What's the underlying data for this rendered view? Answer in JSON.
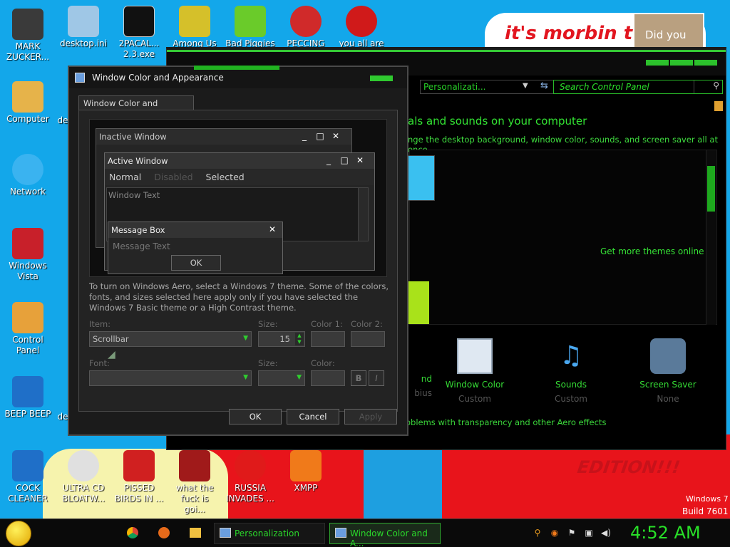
{
  "wallpaper": {
    "banner": "it's morbin t",
    "face_caption": "Did you",
    "edition": "EDITION!!!",
    "os": "Windows 7",
    "build": "Build 7601"
  },
  "desktop_icons": [
    {
      "label": "MARK ZUCKER...",
      "color": "#3a3a3a"
    },
    {
      "label": "Computer",
      "color": "#e6b34a"
    },
    {
      "label": "Network",
      "color": "#3ab3f0"
    },
    {
      "label": "Windows Vista",
      "color": "#c8202a"
    },
    {
      "label": "Control Panel",
      "color": "#e7a13a"
    },
    {
      "label": "BEEP BEEP",
      "color": "#1f6fc8"
    },
    {
      "label": "COCK CLEANER",
      "color": "#1f6fc8"
    },
    {
      "label": "desktop.ini",
      "color": "#9fc7e6"
    },
    {
      "label": "2PACAL... 2.3.exe",
      "color": "#111111"
    },
    {
      "label": "Among Us",
      "color": "#d5c02a"
    },
    {
      "label": "Bad Piggies",
      "color": "#6acb2a"
    },
    {
      "label": "PECCING",
      "color": "#d02a2a"
    },
    {
      "label": "you all are",
      "color": "#d01a1a"
    },
    {
      "label": "ULTRA CD BLOATW...",
      "color": "#e0e0e0"
    },
    {
      "label": "PISSED BIRDS IN ...",
      "color": "#d02020"
    },
    {
      "label": "what the fuck is goi...",
      "color": "#a01a1a"
    },
    {
      "label": "RUSSIA INVADES ...",
      "color": "#e01a1a"
    },
    {
      "label": "XMPP",
      "color": "#f07a1a"
    }
  ],
  "partial_labels": [
    "de",
    "de"
  ],
  "control_panel": {
    "address": "Personalizati...",
    "search_placeholder": "Search Control Panel",
    "heading": "als and sounds on your computer",
    "subheading": "nge the desktop background, window color, sounds, and screen saver all at once.",
    "get_more": "Get more themes online",
    "items": [
      {
        "label": "nd",
        "sub": "bius"
      },
      {
        "label": "Window Color",
        "sub": "Custom"
      },
      {
        "label": "Sounds",
        "sub": "Custom"
      },
      {
        "label": "Screen Saver",
        "sub": "None"
      }
    ],
    "aero_link": "oblems with transparency and other Aero effects"
  },
  "dialog": {
    "title": "Window Color and Appearance",
    "tab": "Window Color and Appearance",
    "preview": {
      "inactive": "Inactive Window",
      "active": "Active Window",
      "menu_normal": "Normal",
      "menu_disabled": "Disabled",
      "menu_selected": "Selected",
      "window_text": "Window Text",
      "msgbox_title": "Message Box",
      "msgbox_text": "Message Text",
      "msgbox_ok": "OK",
      "min": "_",
      "max": "□",
      "close": "✕"
    },
    "info": "To turn on Windows Aero, select a Windows 7 theme.  Some of the colors, fonts, and sizes selected here apply only if you have selected the Windows 7 Basic theme or a High Contrast theme.",
    "item_label": "Item:",
    "item_value": "Scrollbar",
    "size_label": "Size:",
    "size_value": "15",
    "color1_label": "Color 1:",
    "color2_label": "Color 2:",
    "font_label": "Font:",
    "font_size_label": "Size:",
    "font_color_label": "Color:",
    "bold": "B",
    "italic": "I",
    "ok": "OK",
    "cancel": "Cancel",
    "apply": "Apply"
  },
  "taskbar": {
    "buttons": [
      {
        "label": "Personalization"
      },
      {
        "label": "Window Color and A..."
      }
    ],
    "clock": "4:52 AM"
  },
  "colors": {
    "accent": "#2ad82a",
    "desktop": "#13a7ea"
  }
}
